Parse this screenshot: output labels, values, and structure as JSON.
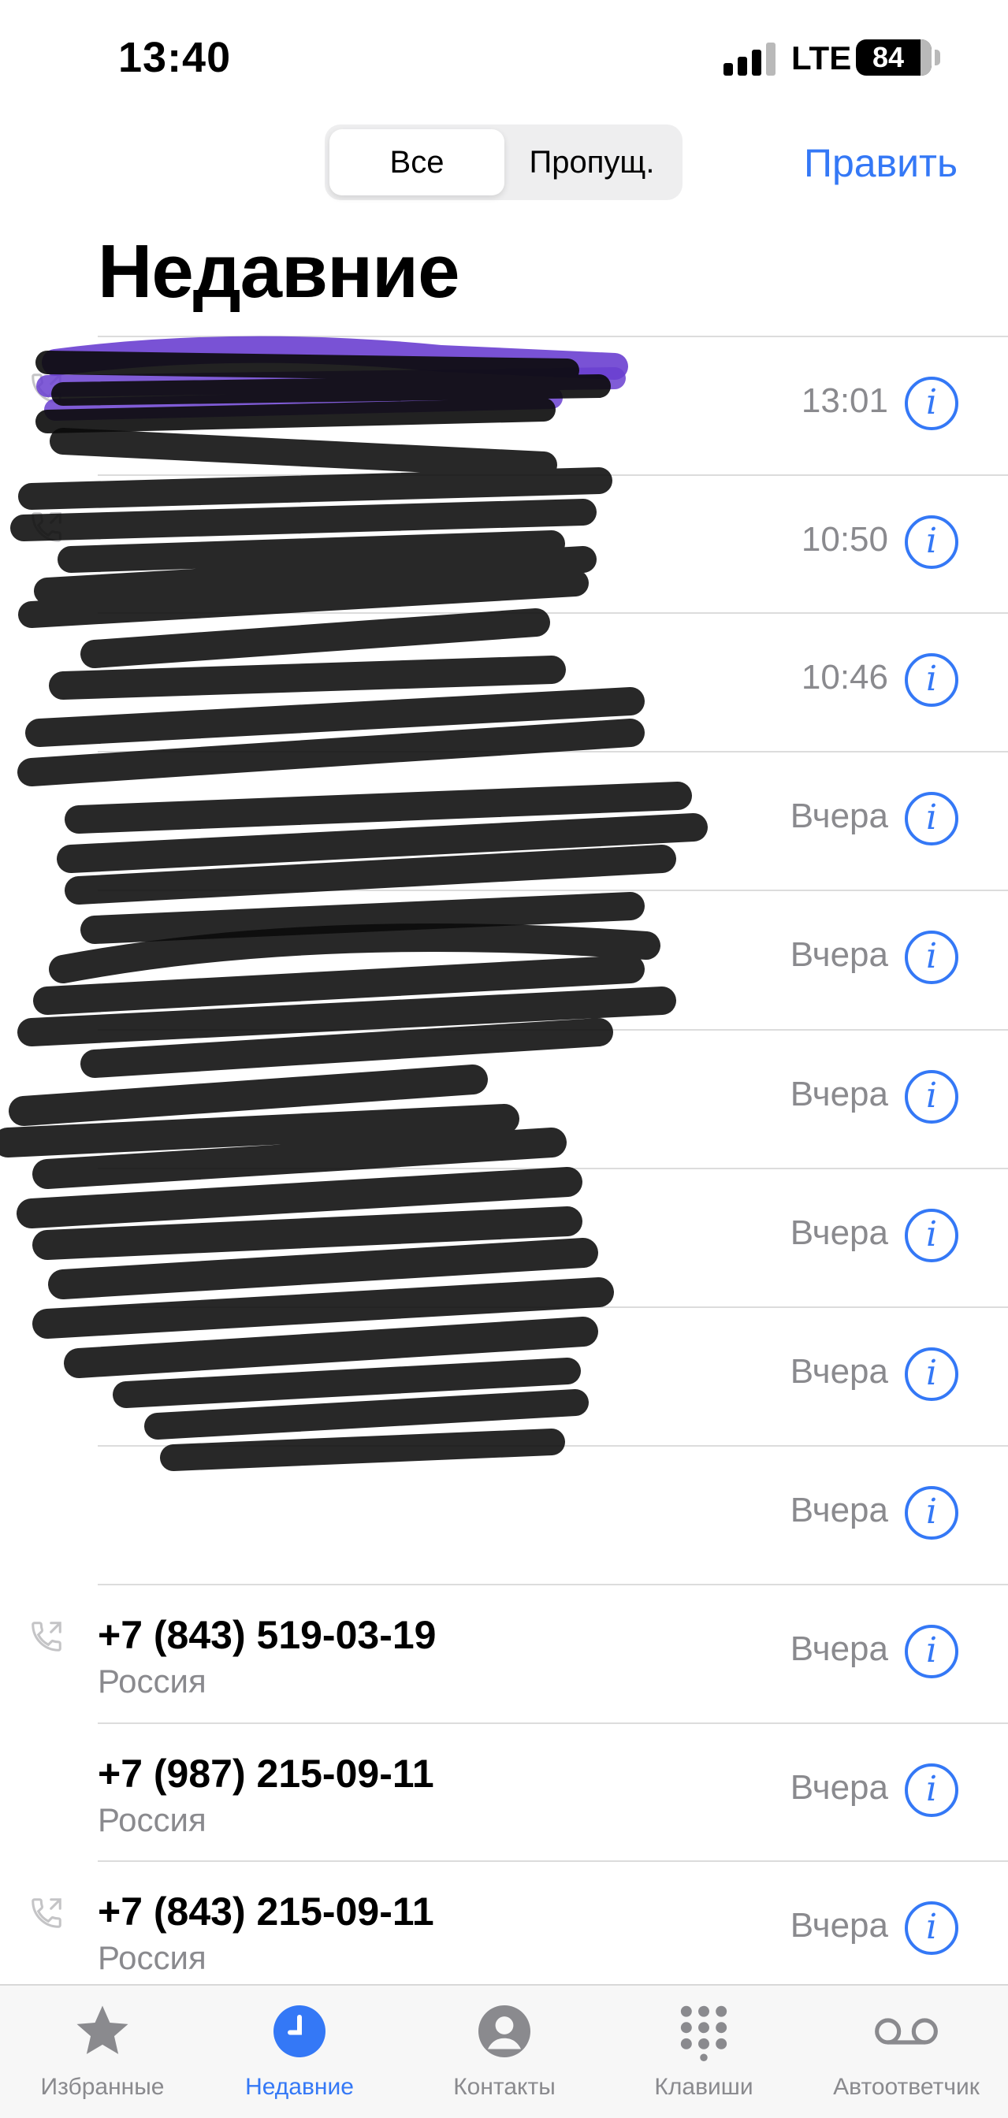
{
  "status_bar": {
    "time": "13:40",
    "network": "LTE",
    "battery": "84"
  },
  "segments": {
    "all": "Все",
    "missed": "Пропущ."
  },
  "edit_label": "Править",
  "title": "Недавние",
  "calls": [
    {
      "name": "",
      "sub": "",
      "time": "13:01",
      "outgoing_icon": true
    },
    {
      "name": "",
      "sub": "",
      "time": "10:50",
      "outgoing_icon": true
    },
    {
      "name": "",
      "sub": "",
      "time": "10:46",
      "outgoing_icon": false
    },
    {
      "name": "",
      "sub": "",
      "time": "Вчера",
      "outgoing_icon": false
    },
    {
      "name": "",
      "sub": "",
      "time": "Вчера",
      "outgoing_icon": false
    },
    {
      "name": "",
      "sub": "",
      "time": "Вчера",
      "outgoing_icon": false
    },
    {
      "name": "",
      "sub": "",
      "time": "Вчера",
      "outgoing_icon": false
    },
    {
      "name": "",
      "sub": "",
      "time": "Вчера",
      "outgoing_icon": false
    },
    {
      "name": "",
      "sub": "",
      "time": "Вчера",
      "outgoing_icon": false
    },
    {
      "name": "+7 (843) 519-03-19",
      "sub": "Россия",
      "time": "Вчера",
      "outgoing_icon": true
    },
    {
      "name": "+7 (987) 215-09-11",
      "sub": "Россия",
      "time": "Вчера",
      "outgoing_icon": false
    },
    {
      "name": "+7 (843) 215-09-11",
      "sub": "Россия",
      "time": "Вчера",
      "outgoing_icon": true
    }
  ],
  "tabs": [
    {
      "label": "Избранные",
      "icon": "star-icon",
      "active": false
    },
    {
      "label": "Недавние",
      "icon": "clock-icon",
      "active": true
    },
    {
      "label": "Контакты",
      "icon": "person-icon",
      "active": false
    },
    {
      "label": "Клавиши",
      "icon": "keypad-icon",
      "active": false
    },
    {
      "label": "Автоответчик",
      "icon": "voicemail-icon",
      "active": false
    }
  ],
  "colors": {
    "accent": "#3478f6",
    "secondary_text": "#8a8a8e",
    "redaction": "#0a0a0a",
    "redaction_highlight": "#6a3fd0"
  }
}
